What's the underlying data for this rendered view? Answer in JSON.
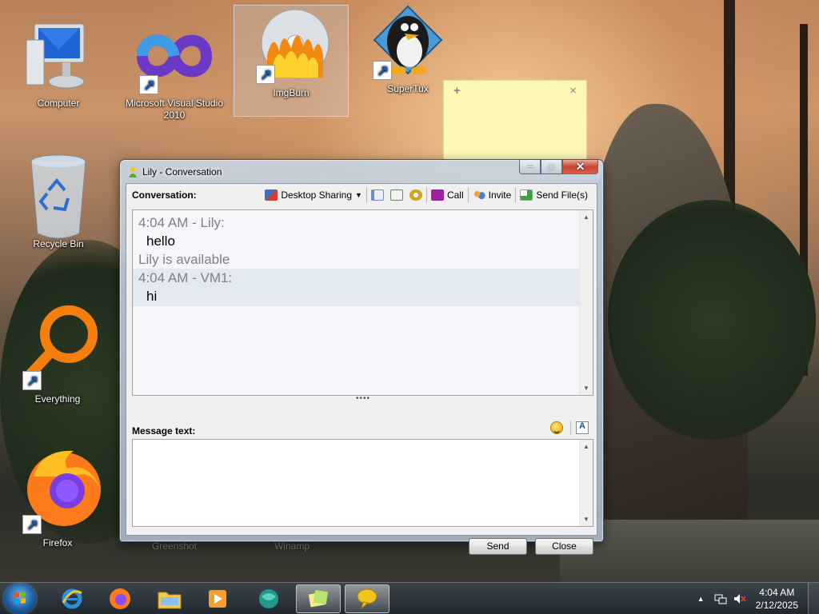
{
  "desktop": {
    "icons": [
      {
        "label": "Computer",
        "icon": "computer-icon"
      },
      {
        "label": "Microsoft Visual Studio 2010",
        "icon": "visual-studio-icon"
      },
      {
        "label": "ImgBurn",
        "icon": "imgburn-icon"
      },
      {
        "label": "SuperTux",
        "icon": "supertux-icon"
      },
      {
        "label": "Recycle Bin",
        "icon": "recycle-bin-icon"
      },
      {
        "label": "Everything",
        "icon": "everything-icon"
      },
      {
        "label": "Firefox",
        "icon": "firefox-icon"
      }
    ],
    "faded_labels": [
      "Greenshot",
      "Winamp"
    ]
  },
  "sticky_note": {
    "add_glyph": "+",
    "close_glyph": "×"
  },
  "window": {
    "title": "Lily - Conversation",
    "toolbar": {
      "conversation_label": "Conversation:",
      "desktop_sharing": "Desktop Sharing",
      "call": "Call",
      "invite": "Invite",
      "send_files": "Send File(s)"
    },
    "history": [
      {
        "meta": "4:04 AM - Lily:",
        "text": "hello"
      },
      {
        "status": "Lily is available"
      },
      {
        "meta": "4:04 AM - VM1:",
        "text": "hi"
      }
    ],
    "message_label": "Message text:",
    "message_value": "",
    "send_button": "Send",
    "close_button": "Close"
  },
  "taskbar": {
    "clock_time": "4:04 AM",
    "clock_date": "2/12/2025"
  },
  "colors": {
    "accent_call": "#a020a0",
    "note_yellow": "#fdf8b6"
  }
}
